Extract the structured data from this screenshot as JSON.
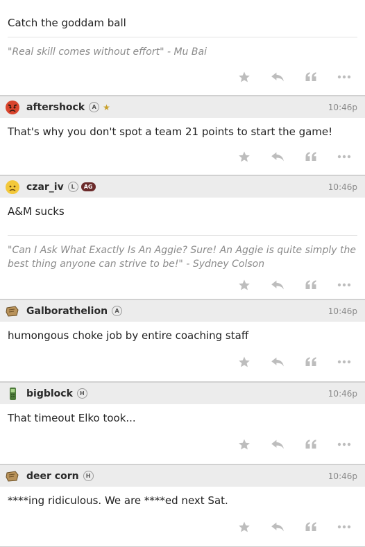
{
  "posts": [
    {
      "id": "p0",
      "username": "",
      "time": "",
      "body": "Catch the goddam ball",
      "signature": "\"Real skill comes without effort\" - Mu Bai"
    },
    {
      "id": "p1",
      "avatar": "angry-face-icon",
      "username": "aftershock",
      "badges": [
        "A"
      ],
      "star": "★",
      "time": "10:46p",
      "body": "That's why you don't spot a team 21 points to start the game!"
    },
    {
      "id": "p2",
      "avatar": "worried-face-icon",
      "username": "czar_iv",
      "badges": [
        "L"
      ],
      "tag": "AG",
      "time": "10:46p",
      "body": "A&M sucks",
      "signature": "\"Can I Ask What Exactly Is An Aggie? Sure! An Aggie is quite simply the best thing anyone can strive to be!\" - Sydney Colson"
    },
    {
      "id": "p3",
      "avatar": "scroll-icon",
      "username": "Galborathelion",
      "badges": [
        "A"
      ],
      "time": "10:46p",
      "body": "humongous choke job by entire coaching staff"
    },
    {
      "id": "p4",
      "avatar": "phone-icon",
      "username": "bigblock",
      "badges": [
        "H"
      ],
      "time": "10:46p",
      "body": "That timeout Elko took..."
    },
    {
      "id": "p5",
      "avatar": "scroll-icon",
      "username": "deer corn",
      "badges": [
        "H"
      ],
      "time": "10:46p",
      "body": "****ing ridiculous. We are ****ed next Sat."
    }
  ],
  "actions": {
    "star": "star-icon",
    "reply": "reply-icon",
    "quote": "quote-icon",
    "more": "more-icon"
  }
}
